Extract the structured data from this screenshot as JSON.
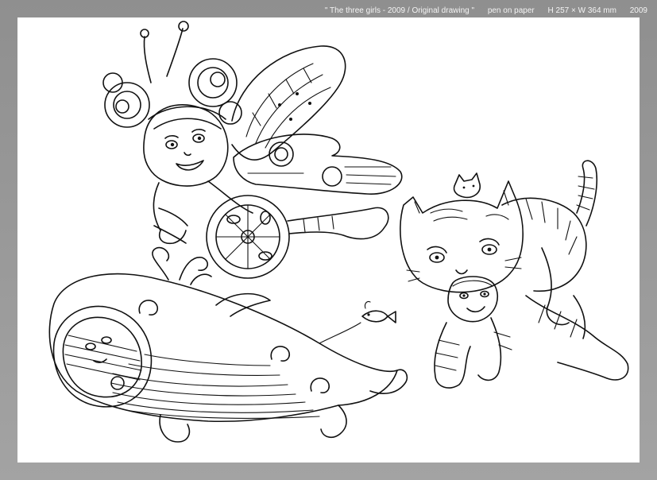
{
  "caption": {
    "title": "\" The three girls - 2009 / Original drawing \"",
    "medium": "pen on paper",
    "dimensions": "H 257 × W 364 mm",
    "year": "2009"
  },
  "drawing": {
    "subjects": [
      "butterfly-girl",
      "whale-girl",
      "cat-girl"
    ],
    "line_color": "#111111",
    "paper_color": "#ffffff",
    "frame_color": "#9a9a9a"
  }
}
